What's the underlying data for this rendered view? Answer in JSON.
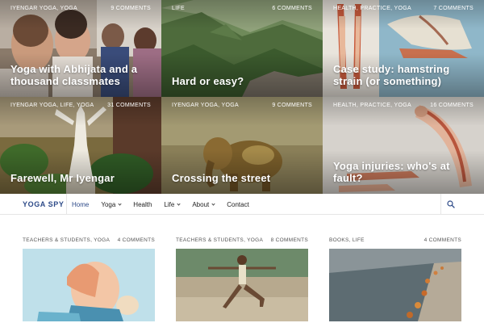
{
  "featured": [
    {
      "categories": "Iyengar yoga, Yoga",
      "comments": "9 Comments",
      "title": "Yoga with Abhijata and a thousand classmates"
    },
    {
      "categories": "Life",
      "comments": "6 Comments",
      "title": "Hard or easy?"
    },
    {
      "categories": "Health, Practice, Yoga",
      "comments": "7 Comments",
      "title": "Case study: hamstring strain (or something)"
    },
    {
      "categories": "Iyengar yoga, Life, Yoga",
      "comments": "31 Comments",
      "title": "Farewell, Mr Iyengar"
    },
    {
      "categories": "Iyengar yoga, Yoga",
      "comments": "9 Comments",
      "title": "Crossing the street"
    },
    {
      "categories": "Health, Practice, Yoga",
      "comments": "16 Comments",
      "title": "Yoga injuries: who's at fault?"
    }
  ],
  "nav": {
    "logo": "YOGA SPY",
    "items": [
      {
        "label": "Home",
        "active": true,
        "dropdown": false
      },
      {
        "label": "Yoga",
        "active": false,
        "dropdown": true
      },
      {
        "label": "Health",
        "active": false,
        "dropdown": false
      },
      {
        "label": "Life",
        "active": false,
        "dropdown": true
      },
      {
        "label": "About",
        "active": false,
        "dropdown": true
      },
      {
        "label": "Contact",
        "active": false,
        "dropdown": false
      }
    ],
    "search_icon": "search-icon"
  },
  "posts": [
    {
      "categories": "Teachers & students, Yoga",
      "comments": "4 Comments"
    },
    {
      "categories": "Teachers & students, Yoga",
      "comments": "8 Comments"
    },
    {
      "categories": "Books, Life",
      "comments": "4 Comments"
    }
  ],
  "colors": {
    "accent": "#2d4a88",
    "nav_border": "#e6e6e6"
  }
}
